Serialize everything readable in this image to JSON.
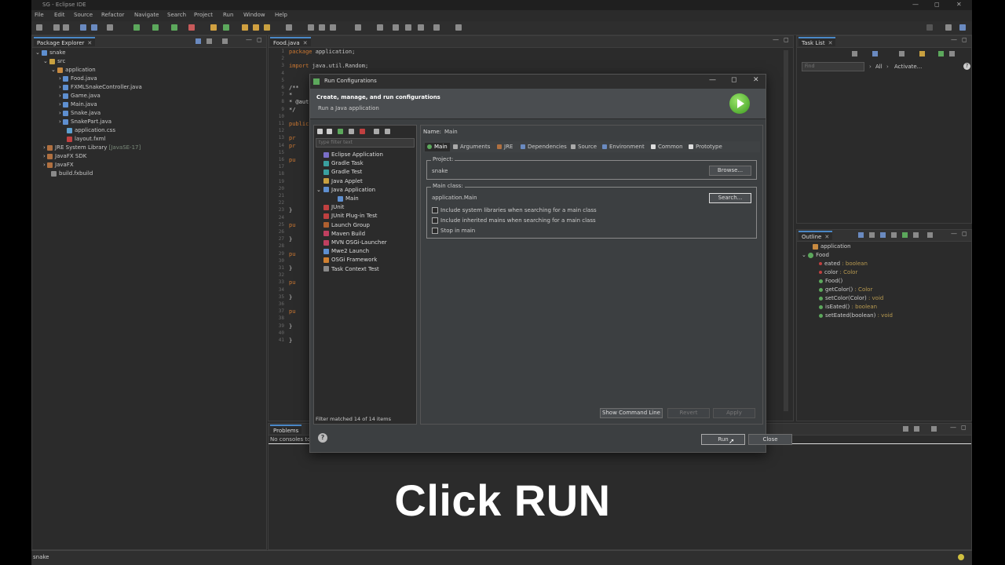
{
  "window": {
    "title": "SG - Eclipse IDE"
  },
  "menu": [
    "File",
    "Edit",
    "Source",
    "Refactor",
    "Navigate",
    "Search",
    "Project",
    "Run",
    "Window",
    "Help"
  ],
  "package_explorer": {
    "tab": "Package Explorer",
    "nodes": [
      {
        "label": "snake"
      },
      {
        "label": "src"
      },
      {
        "label": "application"
      },
      {
        "label": "Food.java"
      },
      {
        "label": "FXMLSnakeController.java"
      },
      {
        "label": "Game.java"
      },
      {
        "label": "Main.java"
      },
      {
        "label": "Snake.java"
      },
      {
        "label": "SnakePart.java"
      },
      {
        "label": "application.css"
      },
      {
        "label": "layout.fxml"
      },
      {
        "label": "JRE System Library",
        "extra": "[JavaSE-17]"
      },
      {
        "label": "JavaFX SDK"
      },
      {
        "label": "JavaFX"
      },
      {
        "label": "build.fxbuild"
      }
    ]
  },
  "editor": {
    "tab": "Food.java",
    "lines": [
      {
        "n": "1",
        "text": "package application;"
      },
      {
        "n": "2",
        "text": ""
      },
      {
        "n": "3",
        "text": "import java.util.Random;"
      },
      {
        "n": "4",
        "text": ""
      },
      {
        "n": "5",
        "text": ""
      },
      {
        "n": "6",
        "text": "/**"
      },
      {
        "n": "7",
        "text": " *"
      },
      {
        "n": "8",
        "text": " * @aut"
      },
      {
        "n": "9",
        "text": " */"
      },
      {
        "n": "10",
        "text": ""
      },
      {
        "n": "11",
        "text": "public"
      },
      {
        "n": "12",
        "text": ""
      },
      {
        "n": "13",
        "text": "    pr"
      },
      {
        "n": "14",
        "text": "    pr"
      },
      {
        "n": "15",
        "text": ""
      },
      {
        "n": "16",
        "text": "    pu"
      },
      {
        "n": "17",
        "text": ""
      },
      {
        "n": "18",
        "text": ""
      },
      {
        "n": "19",
        "text": ""
      },
      {
        "n": "20",
        "text": ""
      },
      {
        "n": "21",
        "text": ""
      },
      {
        "n": "22",
        "text": ""
      },
      {
        "n": "23",
        "text": "    }"
      },
      {
        "n": "24",
        "text": ""
      },
      {
        "n": "25",
        "text": "    pu"
      },
      {
        "n": "26",
        "text": ""
      },
      {
        "n": "27",
        "text": "    }"
      },
      {
        "n": "28",
        "text": ""
      },
      {
        "n": "29",
        "text": "    pu"
      },
      {
        "n": "30",
        "text": ""
      },
      {
        "n": "31",
        "text": "    }"
      },
      {
        "n": "32",
        "text": ""
      },
      {
        "n": "33",
        "text": "    pu"
      },
      {
        "n": "34",
        "text": ""
      },
      {
        "n": "35",
        "text": "    }"
      },
      {
        "n": "36",
        "text": ""
      },
      {
        "n": "37",
        "text": "    pu"
      },
      {
        "n": "38",
        "text": ""
      },
      {
        "n": "39",
        "text": "    }"
      },
      {
        "n": "40",
        "text": ""
      },
      {
        "n": "41",
        "text": "}"
      }
    ]
  },
  "task_list": {
    "tab": "Task List",
    "find_placeholder": "Find",
    "all": "All",
    "activate": "Activate..."
  },
  "outline": {
    "tab": "Outline",
    "nodes": [
      {
        "label": "application",
        "type": ""
      },
      {
        "label": "Food",
        "type": ""
      },
      {
        "label": "eated",
        "type": ": boolean"
      },
      {
        "label": "color",
        "type": ": Color"
      },
      {
        "label": "Food()",
        "type": ""
      },
      {
        "label": "getColor()",
        "type": ": Color"
      },
      {
        "label": "setColor(Color)",
        "type": ": void"
      },
      {
        "label": "isEated()",
        "type": ": boolean"
      },
      {
        "label": "setEated(boolean)",
        "type": ": void"
      }
    ]
  },
  "problems": {
    "tab": "Problems",
    "message": "No consoles to"
  },
  "dialog": {
    "title": "Run Configurations",
    "heading": "Create, manage, and run configurations",
    "subheading": "Run a Java application",
    "filter_placeholder": "type filter text",
    "tree": [
      {
        "label": "Eclipse Application",
        "color": "#7a6fc8",
        "indent": 0
      },
      {
        "label": "Gradle Task",
        "color": "#3aa0a0",
        "indent": 0
      },
      {
        "label": "Gradle Test",
        "color": "#3aa0a0",
        "indent": 0
      },
      {
        "label": "Java Applet",
        "color": "#c8a040",
        "indent": 0
      },
      {
        "label": "Java Application",
        "color": "#5e8fd0",
        "indent": 0
      },
      {
        "label": "Main",
        "color": "#5e8fd0",
        "indent": 1
      },
      {
        "label": "JUnit",
        "color": "#c04040",
        "indent": 0
      },
      {
        "label": "JUnit Plug-in Test",
        "color": "#c04040",
        "indent": 0
      },
      {
        "label": "Launch Group",
        "color": "#b06030",
        "indent": 0
      },
      {
        "label": "Maven Build",
        "color": "#c04060",
        "indent": 0
      },
      {
        "label": "MVN OSGi-Launcher",
        "color": "#c04060",
        "indent": 0
      },
      {
        "label": "Mwe2 Launch",
        "color": "#5e8fd0",
        "indent": 0
      },
      {
        "label": "OSGi Framework",
        "color": "#d08030",
        "indent": 0
      },
      {
        "label": "Task Context Test",
        "color": "#8a8a8a",
        "indent": 0
      }
    ],
    "filter_status": "Filter matched 14 of 14 items",
    "name_label": "Name:",
    "name_value": "Main",
    "tabs": [
      "Main",
      "Arguments",
      "JRE",
      "Dependencies",
      "Source",
      "Environment",
      "Common",
      "Prototype"
    ],
    "project_label": "Project:",
    "project_value": "snake",
    "browse": "Browse...",
    "mainclass_label": "Main class:",
    "mainclass_value": "application.Main",
    "search": "Search...",
    "checks": [
      "Include system libraries when searching for a main class",
      "Include inherited mains when searching for a main class",
      "Stop in main"
    ],
    "show_cmd": "Show Command Line",
    "revert": "Revert",
    "apply": "Apply",
    "run": "Run",
    "close": "Close"
  },
  "status": {
    "text": "snake"
  },
  "caption": "Click RUN"
}
